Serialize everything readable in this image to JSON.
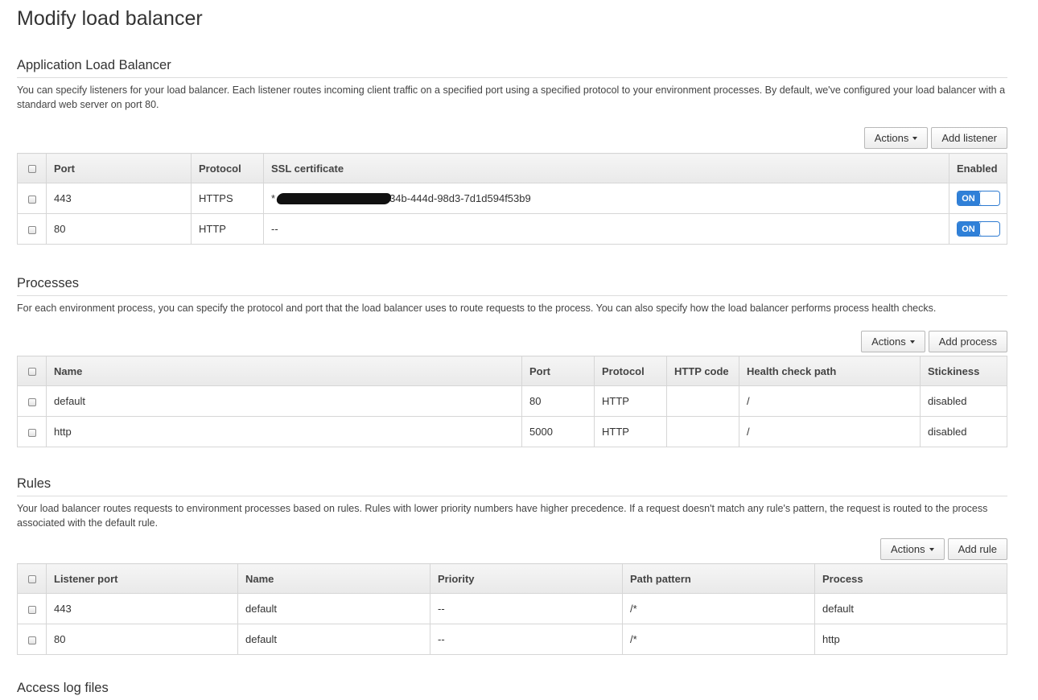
{
  "page_title": "Modify load balancer",
  "alb": {
    "title": "Application Load Balancer",
    "description": "You can specify listeners for your load balancer. Each listener routes incoming client traffic on a specified port using a specified protocol to your environment processes. By default, we've configured your load balancer with a standard web server on port 80.",
    "actions_label": "Actions",
    "add_label": "Add listener",
    "columns": [
      "Port",
      "Protocol",
      "SSL certificate",
      "Enabled"
    ],
    "rows": [
      {
        "port": "443",
        "protocol": "HTTPS",
        "ssl_prefix": "*",
        "ssl_suffix": "34b-444d-98d3-7d1d594f53b9",
        "enabled": "ON"
      },
      {
        "port": "80",
        "protocol": "HTTP",
        "ssl": "--",
        "enabled": "ON"
      }
    ]
  },
  "processes": {
    "title": "Processes",
    "description": "For each environment process, you can specify the protocol and port that the load balancer uses to route requests to the process. You can also specify how the load balancer performs process health checks.",
    "actions_label": "Actions",
    "add_label": "Add process",
    "columns": [
      "Name",
      "Port",
      "Protocol",
      "HTTP code",
      "Health check path",
      "Stickiness"
    ],
    "rows": [
      {
        "name": "default",
        "port": "80",
        "protocol": "HTTP",
        "http_code": "",
        "health_path": "/",
        "stickiness": "disabled"
      },
      {
        "name": "http",
        "port": "5000",
        "protocol": "HTTP",
        "http_code": "",
        "health_path": "/",
        "stickiness": "disabled"
      }
    ]
  },
  "rules": {
    "title": "Rules",
    "description": "Your load balancer routes requests to environment processes based on rules. Rules with lower priority numbers have higher precedence. If a request doesn't match any rule's pattern, the request is routed to the process associated with the default rule.",
    "actions_label": "Actions",
    "add_label": "Add rule",
    "columns": [
      "Listener port",
      "Name",
      "Priority",
      "Path pattern",
      "Process"
    ],
    "rows": [
      {
        "listener_port": "443",
        "name": "default",
        "priority": "--",
        "path": "/*",
        "process": "default"
      },
      {
        "listener_port": "80",
        "name": "default",
        "priority": "--",
        "path": "/*",
        "process": "http"
      }
    ]
  },
  "next_section_title": "Access log files"
}
